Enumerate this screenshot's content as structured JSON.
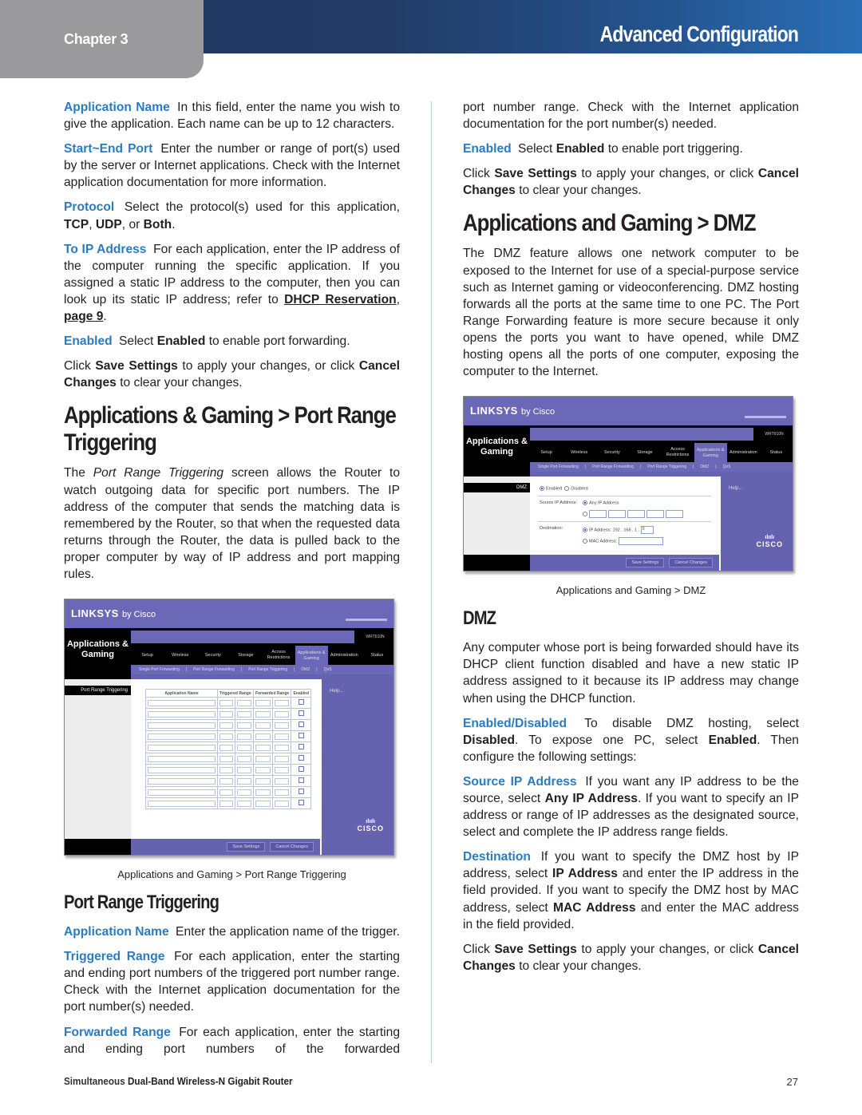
{
  "header": {
    "chapter": "Chapter 3",
    "title": "Advanced Configuration"
  },
  "left": {
    "intro_paras": [
      {
        "term": "Application Name",
        "text": "In this field, enter the name you wish to give the application. Each name can be up to 12 characters."
      },
      {
        "term": "Start~End Port",
        "text": "Enter the number or range of port(s) used by the server or Internet applications. Check with the Internet application documentation for more information."
      }
    ],
    "protocol": {
      "term": "Protocol",
      "pre": "Select the protocol(s) used for this application,",
      "opt1": "TCP",
      "sep1": ", ",
      "opt2": "UDP",
      "sep2": ", or ",
      "opt3": "Both",
      "end": "."
    },
    "to_ip": {
      "term": "To IP Address",
      "text": "For each application, enter the IP address of the computer running the specific application. If you assigned a static IP address to the computer, then you can look up its static IP address; refer to",
      "link1": "DHCP Reservation",
      "comma": ",",
      "link2": "page 9",
      "end": "."
    },
    "enabled": {
      "term": "Enabled",
      "pre": "Select",
      "bold": "Enabled",
      "post": "to enable port forwarding."
    },
    "save": {
      "pre": "Click",
      "b1": "Save Settings",
      "mid": "to apply your changes, or click",
      "b2": "Cancel Changes",
      "post": "to clear your changes."
    },
    "section_title_line1": "Applications & Gaming > Port Range",
    "section_title_line2": "Triggering",
    "section_intro": {
      "pre": "The",
      "italic": "Port Range Triggering",
      "post": "screen allows the Router to watch outgoing data for specific port numbers. The IP address of the computer that sends the matching data is remembered by the Router, so that when the requested data returns through the Router, the data is pulled back to the proper computer by way of IP address and port mapping rules."
    },
    "figure": {
      "logo": "LINKSYS",
      "logo_suffix": "by Cisco",
      "section": "Applications & Gaming",
      "tabs": [
        "Setup",
        "Wireless",
        "Security",
        "Storage",
        "Access Restrictions",
        "Applications & Gaming",
        "Administration",
        "Status"
      ],
      "active_tab": "Applications & Gaming",
      "subtabs": [
        "Single Port Forwarding",
        "Port Range Forwarding",
        "Port Range Triggering",
        "DMZ",
        "QoS"
      ],
      "side_title": "Port Range Triggering",
      "columns": [
        "Application Name",
        "Triggered Range",
        "Forwarded Range",
        "Enabled"
      ],
      "row_count": 10,
      "help": "Help...",
      "save_button": "Save Settings",
      "cancel_button": "Cancel Changes",
      "brand": "CISCO"
    },
    "figure_caption": "Applications and Gaming > Port Range Triggering",
    "subsection_title": "Port Range Triggering",
    "sub_paras": [
      {
        "term": "Application Name",
        "text": "Enter the application name of the trigger."
      },
      {
        "term": "Triggered Range",
        "text": "For each application, enter the starting and ending port numbers of the triggered port number range. Check with the Internet application documentation for the port number(s) needed."
      },
      {
        "term": "Forwarded Range",
        "text": "For each application, enter the starting and ending port numbers of the forwarded"
      }
    ]
  },
  "right": {
    "cont_para": "port number range. Check with the Internet application documentation for the port number(s) needed.",
    "enabled": {
      "term": "Enabled",
      "pre": "Select",
      "bold": "Enabled",
      "post": "to enable port triggering."
    },
    "save": {
      "pre": "Click",
      "b1": "Save Settings",
      "mid": "to apply your changes, or click",
      "b2": "Cancel Changes",
      "post": "to clear your changes."
    },
    "section_title": "Applications and Gaming > DMZ",
    "section_intro": "The DMZ feature allows one network computer to be exposed to the Internet for use of a special-purpose service such as Internet gaming or videoconferencing. DMZ hosting forwards all the ports at the same time to one PC. The Port Range Forwarding feature is more secure because it only opens the ports you want to have opened, while DMZ hosting opens all the ports of one computer, exposing the computer to the Internet.",
    "figure": {
      "logo": "LINKSYS",
      "logo_suffix": "by Cisco",
      "section": "Applications & Gaming",
      "tabs": [
        "Setup",
        "Wireless",
        "Security",
        "Storage",
        "Access Restrictions",
        "Applications & Gaming",
        "Administration",
        "Status"
      ],
      "active_tab": "Applications & Gaming",
      "subtabs": [
        "Single Port Forwarding",
        "Port Range Forwarding",
        "Port Range Triggering",
        "DMZ",
        "QoS"
      ],
      "side_title": "DMZ",
      "enabled_label": "Enabled",
      "disabled_label": "Disabled",
      "source_label": "Source IP Address:",
      "any_ip_label": "Any IP Address",
      "destination_label": "Destination:",
      "ip_address_label": "IP Address:",
      "ip_prefix": "192 . 168 . 1 .",
      "ip_last": "0",
      "mac_address_label": "MAC Address:",
      "help": "Help...",
      "save_button": "Save Settings",
      "cancel_button": "Cancel Changes",
      "brand": "CISCO"
    },
    "figure_caption": "Applications and Gaming > DMZ",
    "subsection_title": "DMZ",
    "dmz_intro": "Any computer whose port is being forwarded should have its DHCP client function disabled and have a new static IP address assigned to it because its IP address may change when using the DHCP function.",
    "enabled_disabled": {
      "term": "Enabled/Disabled",
      "pre": "To disable DMZ hosting, select",
      "b1": "Disabled",
      "mid": ". To expose one PC, select",
      "b2": "Enabled",
      "post": ". Then configure the following settings:"
    },
    "source_ip": {
      "term": "Source IP Address",
      "pre": "If you want any IP address to be the source, select",
      "b1": "Any IP Address",
      "post": ". If you want to specify an IP address or range of IP addresses as the designated source, select and complete the IP address range fields."
    },
    "destination": {
      "term": "Destination",
      "pre": "If you want to specify the DMZ host by IP address, select",
      "b1": "IP Address",
      "mid": "and enter the IP address in the field provided. If you want to specify the DMZ host by MAC address, select",
      "b2": "MAC Address",
      "post": "and enter the MAC address in the field provided."
    },
    "save2": {
      "pre": "Click",
      "b1": "Save Settings",
      "mid": "to apply your changes, or click",
      "b2": "Cancel Changes",
      "post": "to clear your changes."
    }
  },
  "footer": {
    "product_pre": "Simultaneous",
    "product_bold": "Dual-Band Wireless-N Gigabit Router",
    "page_number": "27"
  }
}
